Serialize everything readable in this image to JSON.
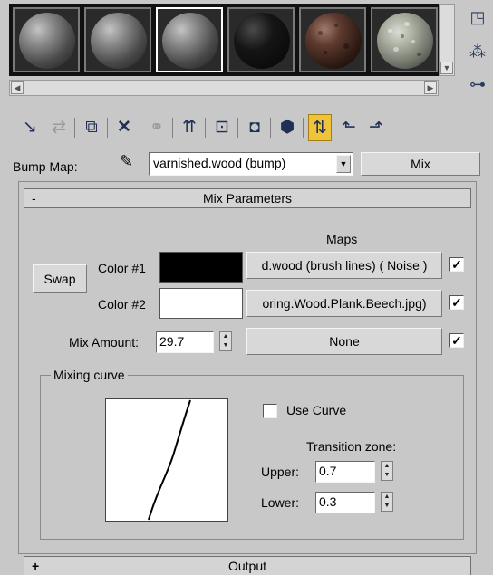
{
  "toolbar": {
    "icons": [
      "get-material-icon",
      "put-to-scene-icon",
      "assign-material-icon",
      "reset-map-icon",
      "make-unique-icon",
      "put-to-library-icon",
      "material-id-icon",
      "show-map-in-viewport-icon",
      "show-end-result-icon",
      "go-to-parent-icon",
      "go-forward-to-sibling-icon"
    ]
  },
  "side_toolbar": {
    "icons": [
      "sample-type-icon",
      "pick-material-icon",
      "material-map-navigator-icon"
    ]
  },
  "bump_map": {
    "label": "Bump Map:",
    "material_name": "varnished.wood (bump)",
    "type_button": "Mix"
  },
  "mix_parameters": {
    "title": "Mix Parameters",
    "collapse_symbol": "-",
    "maps_header": "Maps",
    "swap_label": "Swap",
    "color1": {
      "label": "Color #1",
      "swatch": "#000000",
      "map": "d.wood (brush lines)  ( Noise )",
      "enabled": true
    },
    "color2": {
      "label": "Color #2",
      "swatch": "#ffffff",
      "map": "oring.Wood.Plank.Beech.jpg)",
      "enabled": true
    },
    "mix_amount": {
      "label": "Mix Amount:",
      "value": "29.7",
      "map": "None",
      "enabled": true
    },
    "mixing_curve": {
      "title": "Mixing curve",
      "use_curve_label": "Use Curve",
      "use_curve_checked": false,
      "transition_zone_label": "Transition zone:",
      "upper_label": "Upper:",
      "upper_value": "0.7",
      "lower_label": "Lower:",
      "lower_value": "0.3"
    }
  },
  "output_rollout": {
    "title": "Output",
    "expand_symbol": "+"
  }
}
